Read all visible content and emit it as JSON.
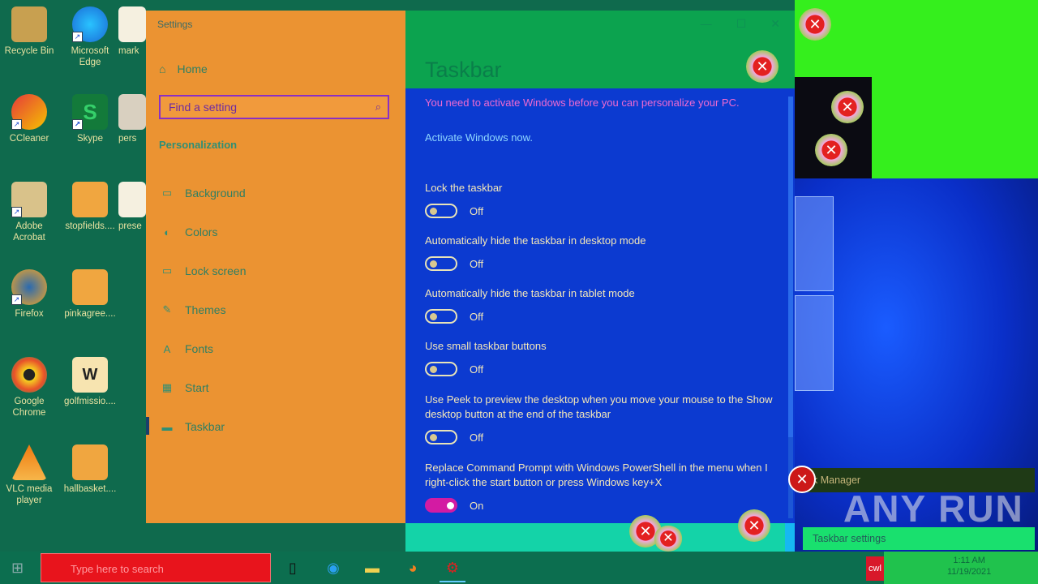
{
  "desktop": {
    "icons": [
      {
        "label": "Recycle Bin",
        "glyph": "recycle-bin-icon"
      },
      {
        "label": "Microsoft Edge",
        "glyph": "edge-icon"
      },
      {
        "label": "mark",
        "glyph": "word-doc-icon"
      },
      {
        "label": "CCleaner",
        "glyph": "ccleaner-icon"
      },
      {
        "label": "Skype",
        "glyph": "skype-icon"
      },
      {
        "label": "pers",
        "glyph": "document-icon"
      },
      {
        "label": "Adobe Acrobat",
        "glyph": "acrobat-icon"
      },
      {
        "label": "stopfields....",
        "glyph": "document-icon"
      },
      {
        "label": "prese",
        "glyph": "word-doc-icon"
      },
      {
        "label": "Firefox",
        "glyph": "firefox-icon"
      },
      {
        "label": "pinkagree....",
        "glyph": "document-icon"
      },
      {
        "label": "Google Chrome",
        "glyph": "chrome-icon"
      },
      {
        "label": "golfmissio....",
        "glyph": "word-doc-icon"
      },
      {
        "label": "VLC media player",
        "glyph": "vlc-icon"
      },
      {
        "label": "hallbasket....",
        "glyph": "document-icon"
      }
    ]
  },
  "settings": {
    "window_title": "Settings",
    "home_label": "Home",
    "search_placeholder": "Find a setting",
    "section_title": "Personalization",
    "nav_items": [
      {
        "label": "Background",
        "icon": "image-icon"
      },
      {
        "label": "Colors",
        "icon": "palette-icon"
      },
      {
        "label": "Lock screen",
        "icon": "lock-screen-icon"
      },
      {
        "label": "Themes",
        "icon": "brush-icon"
      },
      {
        "label": "Fonts",
        "icon": "font-icon"
      },
      {
        "label": "Start",
        "icon": "start-icon"
      },
      {
        "label": "Taskbar",
        "icon": "taskbar-icon",
        "active": true
      }
    ],
    "page_title": "Taskbar",
    "warning": "You need to activate Windows before you can personalize your PC.",
    "activate_link": "Activate Windows now.",
    "options": [
      {
        "label": "Lock the taskbar",
        "state": "Off",
        "on": false
      },
      {
        "label": "Automatically hide the taskbar in desktop mode",
        "state": "Off",
        "on": false
      },
      {
        "label": "Automatically hide the taskbar in tablet mode",
        "state": "Off",
        "on": false
      },
      {
        "label": "Use small taskbar buttons",
        "state": "Off",
        "on": false
      },
      {
        "label": "Use Peek to preview the desktop when you move your mouse to the Show desktop button at the end of the taskbar",
        "state": "Off",
        "on": false
      },
      {
        "label": "Replace Command Prompt with Windows PowerShell in the menu when I right-click the start button or press Windows key+X",
        "state": "On",
        "on": true
      }
    ]
  },
  "tooltips": {
    "task_manager": "k Manager",
    "taskbar_settings": "Taskbar settings"
  },
  "taskbar": {
    "search_placeholder": "Type here to search",
    "tray_label": "cwl",
    "clock_time": "1:11 AM",
    "clock_date": "11/19/2021"
  },
  "watermark": "ANY RUN",
  "colors": {
    "sidebar_bg": "#eb9332",
    "content_bg": "#0c3ad0",
    "accent_toggle_on": "#d31ba3"
  }
}
